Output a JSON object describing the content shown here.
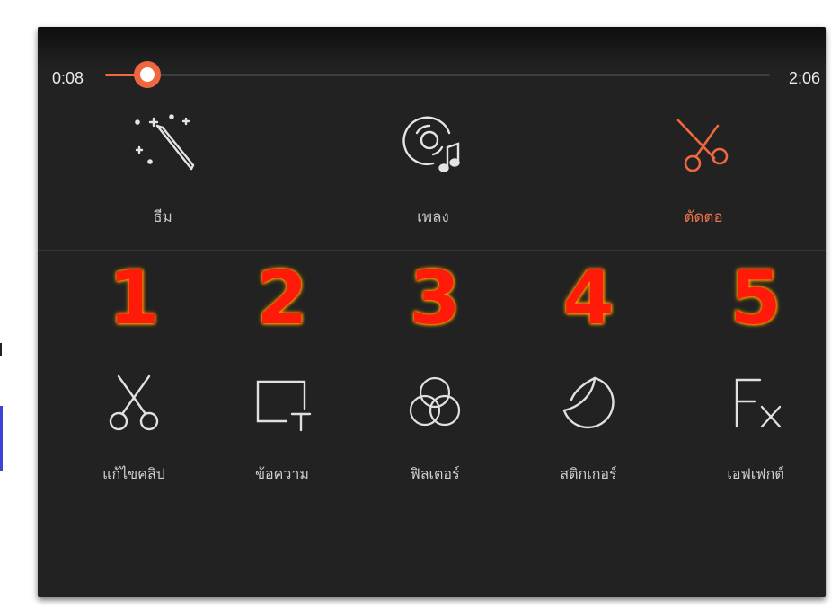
{
  "player": {
    "current_time": "0:08",
    "total_time": "2:06",
    "progress": 0.063
  },
  "tabs": [
    {
      "label": "ธีม",
      "icon": "magic-wand-icon",
      "active": false
    },
    {
      "label": "เพลง",
      "icon": "music-disc-icon",
      "active": false
    },
    {
      "label": "ตัดต่อ",
      "icon": "scissors-icon",
      "active": true
    }
  ],
  "tools": [
    {
      "number": "1",
      "label": "แก้ไขคลิป",
      "icon": "scissors-icon"
    },
    {
      "number": "2",
      "label": "ข้อความ",
      "icon": "text-box-icon"
    },
    {
      "number": "3",
      "label": "ฟิลเตอร์",
      "icon": "filter-circles-icon"
    },
    {
      "number": "4",
      "label": "สติกเกอร์",
      "icon": "sticker-icon"
    },
    {
      "number": "5",
      "label": "เอฟเฟกต์",
      "icon": "fx-icon"
    }
  ],
  "colors": {
    "accent": "#f1673f",
    "panel_bg": "#222222",
    "annotation_number": "#ff1a0a"
  }
}
